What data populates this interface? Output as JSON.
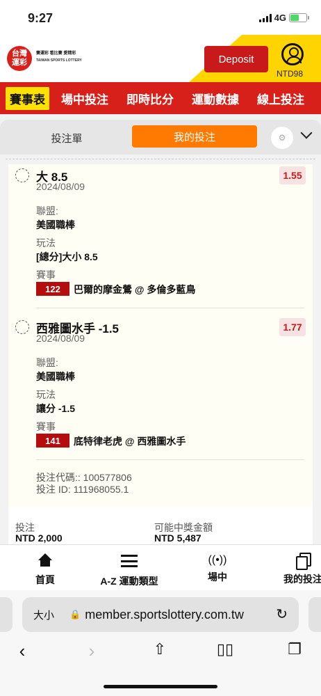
{
  "status": {
    "time": "9:27",
    "network": "4G"
  },
  "header": {
    "logo_line1": "台灣",
    "logo_line2": "運彩",
    "logo_title": "賽運彩 看比賽 愛精彩",
    "logo_subtitle": "TAIWAN SPORTS LOTTERY",
    "deposit_label": "Deposit",
    "balance": "NTD98"
  },
  "nav": {
    "items": [
      "賽事表",
      "場中投注",
      "即時比分",
      "運動數據",
      "線上投注"
    ]
  },
  "slip": {
    "tab_slip": "投注單",
    "tab_mybets": "我的投注",
    "gear": "⚙"
  },
  "bets": [
    {
      "selection": "大 8.5",
      "date": "2024/08/09",
      "odds": "1.55",
      "league_label": "聯盟:",
      "league": "美國職棒",
      "market_label": "玩法",
      "market": "[總分]大小 8.5",
      "event_label": "賽事",
      "event_code": "122",
      "event_name": "巴爾的摩金鶯 @ 多倫多藍鳥"
    },
    {
      "selection": "西雅圖水手 -1.5",
      "date": "2024/08/09",
      "odds": "1.77",
      "league_label": "聯盟:",
      "league": "美國職棒",
      "market_label": "玩法",
      "market": "讓分 -1.5",
      "event_label": "賽事",
      "event_code": "141",
      "event_name": "底特律老虎 @ 西雅圖水手"
    }
  ],
  "meta": {
    "bet_code": "投注代碼:: 100577806",
    "bet_id": "投注 ID: 111968055.1"
  },
  "totals": {
    "stake_label": "投注",
    "stake_value": "NTD 2,000",
    "payout_label": "可能中獎金額",
    "payout_value": "NTD 5,487"
  },
  "bottom_nav": {
    "home": "首頁",
    "az": "A-Z 運動類型",
    "live": "場中",
    "mybets": "我的投注"
  },
  "browser": {
    "aa": "大小",
    "url": "member.sportslottery.com.tw"
  }
}
